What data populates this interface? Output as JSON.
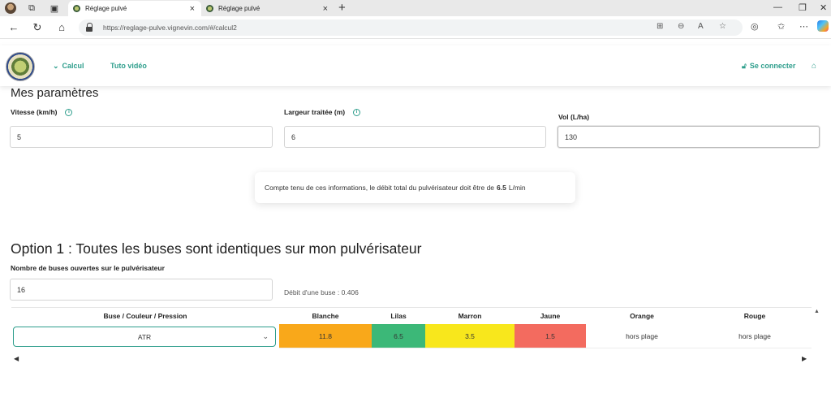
{
  "browser": {
    "tabs": [
      {
        "title": "Réglage pulvé",
        "active": true
      },
      {
        "title": "Réglage pulvé",
        "active": false
      }
    ],
    "url": "https://reglage-pulve.vignevin.com/#/calcul2"
  },
  "nav": {
    "calcul": "Calcul",
    "tuto": "Tuto vidéo",
    "connect": "Se connecter"
  },
  "params": {
    "title": "Mes paramètres",
    "vitesse": {
      "label": "Vitesse (km/h)",
      "value": "5"
    },
    "largeur": {
      "label": "Largeur traitée (m)",
      "value": "6"
    },
    "vol": {
      "label": "Vol (L/ha)",
      "value": "130"
    }
  },
  "notice": {
    "text": "Compte tenu de ces informations, le débit total du pulvérisateur doit être de",
    "value": "6.5",
    "unit": "L/min"
  },
  "option1": {
    "title": "Option 1 : Toutes les buses sont identiques sur mon pulvérisateur",
    "nb_label": "Nombre de buses ouvertes sur le pulvérisateur",
    "nb_value": "16",
    "debit": "Débit d'une buse : 0.406"
  },
  "table": {
    "headers": [
      "Buse / Couleur / Pression",
      "Blanche",
      "Lilas",
      "Marron",
      "Jaune",
      "Orange",
      "Rouge"
    ],
    "select_value": "ATR",
    "values": [
      "11.8",
      "6.5",
      "3.5",
      "1.5",
      "hors plage",
      "hors plage"
    ],
    "cell_colors": [
      "#f9a81a",
      "#3cb878",
      "#f8e71c",
      "#f36b5f",
      "#ffffff",
      "#ffffff"
    ]
  }
}
